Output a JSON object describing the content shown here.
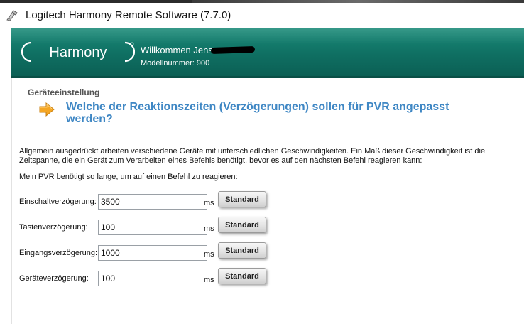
{
  "window": {
    "title": "Logitech Harmony Remote Software (7.7.0)"
  },
  "header": {
    "logo_text": "Harmony",
    "welcome": "Willkommen Jens",
    "model_label": "Modellnummer: 900"
  },
  "page": {
    "section": "Geräteeinstellung",
    "question": "Welche der Reaktionszeiten (Verzögerungen) sollen für PVR angepasst werden?",
    "description": "Allgemein ausgedrückt arbeiten verschiedene Geräte mit unterschiedlichen Geschwindigkeiten. Ein Maß dieser Geschwindigkeit ist die Zeitspanne, die ein Gerät zum Verarbeiten eines Befehls benötigt, bevor es auf den nächsten Befehl reagieren kann:",
    "intro": "Mein PVR benötigt so lange, um auf einen Befehl zu reagieren:"
  },
  "delays": [
    {
      "label": "Einschaltverzögerung:",
      "value": "3500",
      "unit": "ms",
      "button": "Standard"
    },
    {
      "label": "Tastenverzögerung:",
      "value": "100",
      "unit": "ms",
      "button": "Standard"
    },
    {
      "label": "Eingangsverzögerung:",
      "value": "1000",
      "unit": "ms",
      "button": "Standard"
    },
    {
      "label": "Geräteverzögerung:",
      "value": "100",
      "unit": "ms",
      "button": "Standard"
    }
  ],
  "icons": {
    "app": "app-icon",
    "arrow": "arrow-right-icon"
  },
  "colors": {
    "banner": "#0f6f62",
    "question": "#3f87c4",
    "arrow": "#f5a623"
  }
}
